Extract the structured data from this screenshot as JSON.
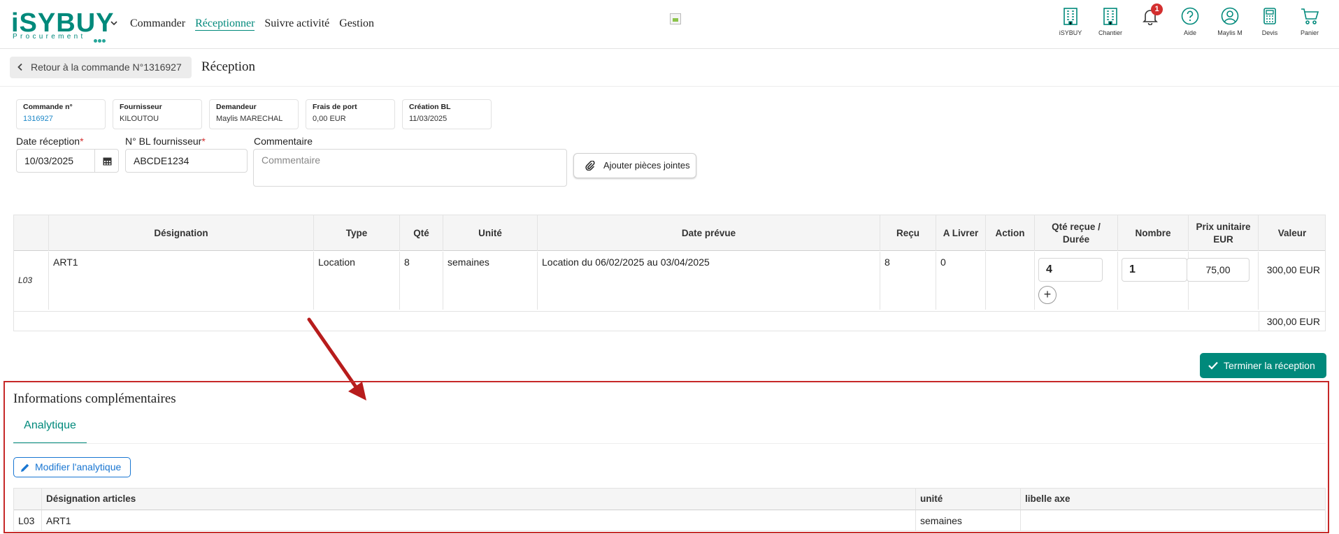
{
  "colors": {
    "accent": "#00897b",
    "link": "#1e88c8",
    "danger": "#d32f2f",
    "annotation": "#c62828",
    "primary_outline": "#1976d2"
  },
  "header": {
    "logo_main": "iSYBUY",
    "logo_sub": "Procurement",
    "nav": [
      "Commander",
      "Réceptionner",
      "Suivre activité",
      "Gestion"
    ],
    "active_nav": "Réceptionner",
    "notification_count": "1",
    "icons": [
      {
        "icon": "building-icon",
        "label": "iSYBUY"
      },
      {
        "icon": "building-icon",
        "label": "Chantier"
      },
      {
        "icon": "bell-icon",
        "label": ""
      },
      {
        "icon": "help-icon",
        "label": "Aide"
      },
      {
        "icon": "user-icon",
        "label": "Maylis M"
      },
      {
        "icon": "calculator-icon",
        "label": "Devis"
      },
      {
        "icon": "cart-icon",
        "label": "Panier"
      }
    ]
  },
  "page": {
    "back_label": "Retour à la commande N°1316927",
    "title": "Réception"
  },
  "info": [
    {
      "label": "Commande n°",
      "value": "1316927"
    },
    {
      "label": "Fournisseur",
      "value": "KILOUTOU"
    },
    {
      "label": "Demandeur",
      "value": "Maylis MARECHAL"
    },
    {
      "label": "Frais de port",
      "value": "0,00 EUR"
    },
    {
      "label": "Création BL",
      "value": "11/03/2025"
    }
  ],
  "form": {
    "date_label": "Date réception",
    "date_value": "10/03/2025",
    "bl_label": "N° BL fournisseur",
    "bl_value": "ABCDE1234",
    "comment_label": "Commentaire",
    "comment_placeholder": "Commentaire",
    "required_mark": "*",
    "attach_label": "Ajouter pièces jointes"
  },
  "table": {
    "headers": [
      "Désignation",
      "Type",
      "Qté",
      "Unité",
      "Date prévue",
      "Reçu",
      "A Livrer",
      "Action",
      "Qté reçue /",
      "Durée",
      "Nombre",
      "Prix unitaire",
      "EUR",
      "Valeur"
    ],
    "row": {
      "line": "L03",
      "designation": "ART1",
      "type": "Location",
      "qty": "8",
      "unit": "semaines",
      "date": "Location du 06/02/2025 au 03/04/2025",
      "received": "8",
      "to_deliver": "0",
      "qty_received": "4",
      "count": "1",
      "unit_price": "75,00",
      "value": "300,00 EUR"
    },
    "plus": "+",
    "total": "300,00 EUR"
  },
  "finish_label": "Terminer la réception",
  "extra": {
    "title": "Informations complémentaires",
    "tab": "Analytique",
    "edit_label": "Modifier l'analytique",
    "headers": [
      "Désignation articles",
      "unité",
      "libelle axe"
    ],
    "row": {
      "line": "L03",
      "designation": "ART1",
      "unit": "semaines",
      "axis": ""
    }
  }
}
